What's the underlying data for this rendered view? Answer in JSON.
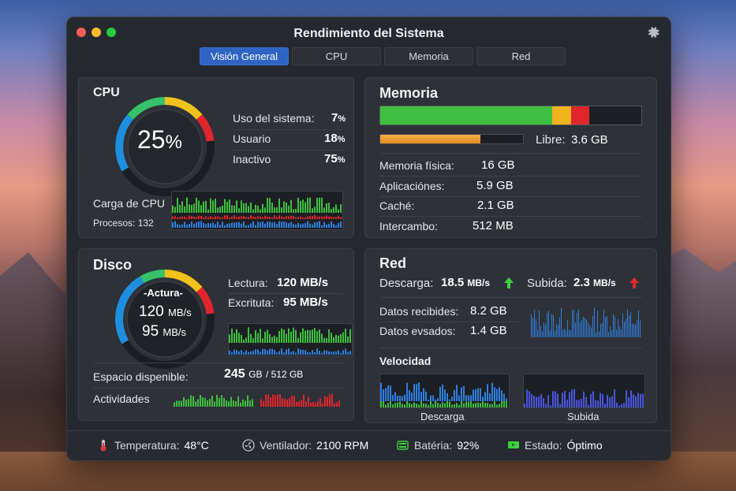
{
  "window": {
    "title": "Rendimiento del Sistema"
  },
  "tabs": [
    {
      "label": "Visión General",
      "active": true
    },
    {
      "label": "CPU",
      "active": false
    },
    {
      "label": "Memoria",
      "active": false
    },
    {
      "label": "Red",
      "active": false
    }
  ],
  "cpu": {
    "title": "CPU",
    "gauge_value": "25",
    "gauge_unit": "%",
    "stats": [
      {
        "label": "Uso del sistema:",
        "value": "7",
        "unit": "%"
      },
      {
        "label": "Usuario",
        "value": "18",
        "unit": "%"
      },
      {
        "label": "Inactivo",
        "value": "75",
        "unit": "%"
      }
    ],
    "load_label": "Carga de CPU",
    "processes_label": "Procesos:",
    "processes_value": "132"
  },
  "memory": {
    "title": "Memoria",
    "bar_segments": [
      {
        "color": "#3fbf3f",
        "fraction": 0.66
      },
      {
        "color": "#f2b21b",
        "fraction": 0.07
      },
      {
        "color": "#e0262b",
        "fraction": 0.07
      }
    ],
    "swap_fraction": 0.7,
    "free_label": "Libre:",
    "free_value": "3.6 GB",
    "rows": [
      {
        "label": "Memoria física:",
        "value": "16 GB"
      },
      {
        "label": "Aplicaciónes:",
        "value": "5.9 GB"
      },
      {
        "label": "Caché:",
        "value": "2.1 GB"
      },
      {
        "label": "Intercambo:",
        "value": "512 MB"
      }
    ]
  },
  "disk": {
    "title": "Disco",
    "gauge_caption": "-Actura-",
    "gauge_read": "120",
    "gauge_read_unit": "MB/s",
    "gauge_write": "95",
    "gauge_write_unit": "MB/s",
    "read_label": "Lectura:",
    "read_value": "120 MB/s",
    "write_label": "Excrituta:",
    "write_value": "95 MB/s",
    "space_label": "Espacio dispenible:",
    "space_used": "245",
    "space_used_unit": "GB",
    "space_total": "/ 512 GB",
    "activity_label": "Actividades"
  },
  "network": {
    "title": "Red",
    "download_label": "Descarga:",
    "download_value": "18.5",
    "download_unit": "MB/s",
    "upload_label": "Subida:",
    "upload_value": "2.3",
    "upload_unit": "MB/s",
    "received_label": "Datos recibides:",
    "received_value": "8.2 GB",
    "sent_label": "Datos evsados:",
    "sent_value": "1.4 GB",
    "speed_label": "Velocidad",
    "chart_download_label": "Descarga",
    "chart_upload_label": "Subida"
  },
  "footer": {
    "temp_label": "Temperatura:",
    "temp_value": "48°C",
    "fan_label": "Ventilador:",
    "fan_value": "2100 RPM",
    "battery_label": "Batéria:",
    "battery_value": "92%",
    "status_label": "Estado:",
    "status_value": "Óptimo"
  },
  "colors": {
    "accent": "#2f64c4",
    "green": "#3fbf3f",
    "yellow": "#f2b21b",
    "red": "#e0262b",
    "blue": "#2f7fe0",
    "cyan": "#22a9e8"
  }
}
